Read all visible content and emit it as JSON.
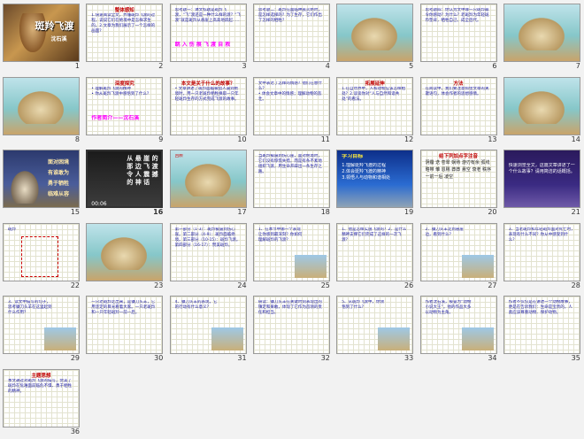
{
  "slides": [
    {
      "n": "1",
      "type": "cover",
      "title": "斑羚飞渡",
      "text": "沈石溪"
    },
    {
      "n": "2",
      "type": "text",
      "title": "整体感知",
      "text": "1.快速阅读全文，弄懂斑羚飞渡的过程，说说它们在绝境中是怎样求生的。2.文章为我们展示了一个怎样的画面？"
    },
    {
      "n": "3",
      "type": "text",
      "title": "",
      "text": "思考题一：课文标题是斑羚飞渡，“飞”渡还是一种什么样的渡？“飞渡”就是斑羚从悬崖上高高地跃起……",
      "accent": "跳 入 伤 痕         飞 渡 自 救"
    },
    {
      "n": "4",
      "type": "text",
      "title": "",
      "text": "思考题二：斑羚在面临种族灭绝时，是怎样选择的？为了生存，它们作出了怎样的牺牲？"
    },
    {
      "n": "5",
      "type": "picture",
      "title": "",
      "text": ""
    },
    {
      "n": "6",
      "type": "text",
      "title": "",
      "text": "思考题四：你认为文中哪一只斑羚最令你感动？为什么？老斑羚为年轻斑羚垫背，牺牲自己，成全后代。"
    },
    {
      "n": "7",
      "type": "picture",
      "title": "",
      "text": ""
    },
    {
      "n": "8",
      "type": "picture",
      "title": "",
      "text": ""
    },
    {
      "n": "9",
      "type": "text",
      "title": "深度探究",
      "text": "• 理解斑羚飞渡的精神\n• 你从斑羚飞渡中感悟到了什么？",
      "accent": "作者简介——沈石溪"
    },
    {
      "n": "10",
      "type": "text",
      "title": "本文是关于什么的故事？",
      "text": "• 文章讲述了斑羚面临被猎人逼到绝境时，用一只老斑羚牺牲换取一只年轻斑羚生存的方式完成飞渡的故事。"
    },
    {
      "n": "11",
      "type": "text",
      "title": "",
      "text": "文中表达了怎样的情感？他们在想什么？\n• 体会文章中的情感；理解动物的悲壮。"
    },
    {
      "n": "12",
      "type": "text",
      "title": "拓展延伸",
      "text": "1.在自然界中，人和动物应该怎样相处？2.谈谈你对“人与自然和谐共处”的看法。"
    },
    {
      "n": "13",
      "type": "text",
      "title": "方法",
      "text": "在阅读中，我们要注意抓住文章的关键语句，体会作者的思想感情。"
    },
    {
      "n": "14",
      "type": "picture",
      "title": "",
      "text": ""
    },
    {
      "n": "15",
      "type": "dark",
      "title": "",
      "text": "面对困境 有谁敢为 勇于牺牲 临难从容"
    },
    {
      "n": "16",
      "type": "darkpoem",
      "title": "",
      "text": "从 悬 崖 的 那 边 飞 渡 令 人 震 撼 的 神 话",
      "label": "00:06"
    },
    {
      "n": "17",
      "type": "picture",
      "title": "",
      "text": "回顾"
    },
    {
      "n": "18",
      "type": "text",
      "title": "",
      "text": "当斑羚被逼到伤心崖，面对绝境时，它们没有惊慌失措，而是有条不紊地组织飞渡，用生命开辟出一条生存之路。"
    },
    {
      "n": "19",
      "type": "blue",
      "title": "学习目标",
      "text": "1.理解斑羚飞渡的过程\n2.体会斑羚飞渡的精神\n3.领悟人与动物和谐相处"
    },
    {
      "n": "20",
      "type": "words",
      "title": "给下列加点字注音",
      "text": "阴霾 迭 苍翠 娴熟 游刃有余 弧线 略带 雏 恩赐 莽莽 悬空 衰老 秩序 一前一后 凌空"
    },
    {
      "n": "21",
      "type": "purple",
      "title": "",
      "text": "快速浏览全文，这篇文章讲述了一个什么故事？请用简洁的话概括。"
    },
    {
      "n": "22",
      "type": "diagram",
      "title": "",
      "text": "斑羚"
    },
    {
      "n": "23",
      "type": "picture",
      "title": "",
      "text": ""
    },
    {
      "n": "24",
      "type": "text",
      "title": "",
      "text": "第一部分（1-3）：斑羚被逼到伤心崖。第二部分（4-9）：斑羚面临绝境。第三部分（10-15）：斑羚飞渡。第四部分（16-17）：赞美斑羚。"
    },
    {
      "n": "25",
      "type": "textpic",
      "title": "",
      "text": "1、在本节中哪一个表现让你感到最深刻？你如何理解斑羚的飞渡？"
    },
    {
      "n": "26",
      "type": "text",
      "title": "",
      "text": "1、他是怎样实施飞渡的？2、是什么精神支撑它们完成了这样的一次飞渡？"
    },
    {
      "n": "27",
      "type": "textpic",
      "title": "",
      "text": "2、镰刀头羊走到悬崖边，看到什么？"
    },
    {
      "n": "28",
      "type": "text",
      "title": "",
      "text": "3、当老斑羚和年轻斑羚面对死亡时，表现有什么不同？你从中感受到什么？"
    },
    {
      "n": "29",
      "type": "textpic",
      "title": "",
      "text": "3、读文中描写的句子，思考镰刀头羊在这里起到什么作用？"
    },
    {
      "n": "30",
      "type": "text",
      "title": "",
      "text": "一只老斑羚走出来，是镰刀头羊，它用坚定的目光看着大家。一只老斑羚和一只年轻斑羚一前一后。"
    },
    {
      "n": "31",
      "type": "textpic",
      "title": "",
      "text": "4、镰刀头羊的表现，它的行动有什么意义？"
    },
    {
      "n": "32",
      "type": "text",
      "title": "",
      "text": "研读：镰刀头羊在关键时刻表现出的镇定和果敢，体现了它作为首领的责任和担当。"
    },
    {
      "n": "33",
      "type": "textpic",
      "title": "",
      "text": "5、从斑羚飞渡中，你领悟到了什么？"
    },
    {
      "n": "34",
      "type": "textpic",
      "title": "",
      "text": "作者沈石溪，被誉为“动物小说大王”。他的作品大多以动物为主角。"
    },
    {
      "n": "35",
      "type": "text",
      "title": "",
      "text": "作者不仅仅是在讲述一个动物故事，更是在告诉我们：生命是宝贵的，人类应该尊重动物、保护动物。"
    },
    {
      "n": "36",
      "type": "text",
      "title": "主题思想",
      "text": "本文通过对斑羚飞渡的描写，赞美了斑羚在危难面前临危不惧、勇于牺牲的精神。"
    }
  ],
  "selected": "16"
}
